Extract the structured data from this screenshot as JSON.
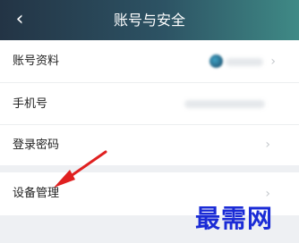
{
  "header": {
    "title": "账号与安全",
    "back_icon": "chevron-left-icon",
    "back_glyph": "‹"
  },
  "rows": [
    {
      "label": "账号资料",
      "chevron": "›"
    },
    {
      "label": "手机号"
    },
    {
      "label": "登录密码",
      "chevron": "›"
    },
    {
      "label": "设备管理",
      "chevron": "›"
    }
  ],
  "watermark": {
    "text": "最需网"
  },
  "colors": {
    "header_start": "#233445",
    "header_end": "#3f8a86",
    "arrow": "#e02020",
    "watermark": "#1a2bd6"
  }
}
